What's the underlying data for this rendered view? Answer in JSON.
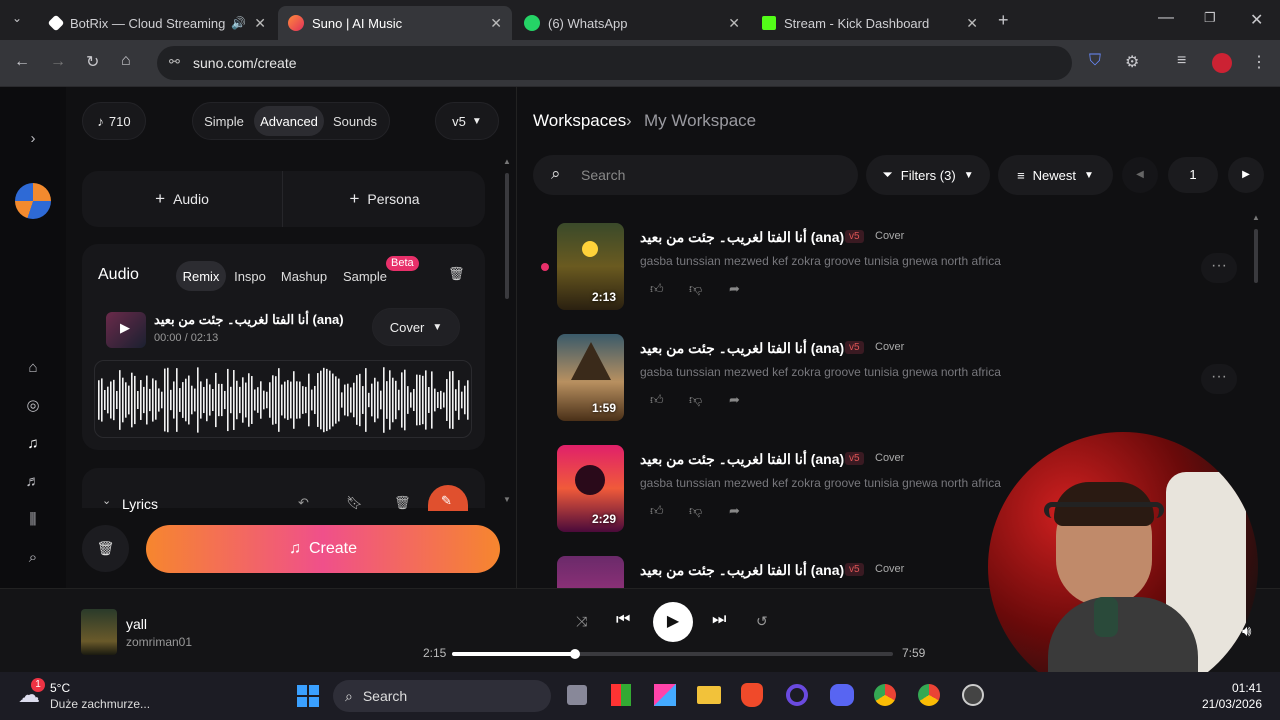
{
  "browser": {
    "tabs": [
      {
        "title": "BotRix — Cloud Streaming",
        "fav_color": "#ffffff",
        "active": false
      },
      {
        "title": "Suno | AI Music",
        "fav_color": "#ff5a3c",
        "active": true
      },
      {
        "title": "(6) WhatsApp",
        "fav_color": "#25d366",
        "active": false
      },
      {
        "title": "Stream - Kick Dashboard",
        "fav_color": "#53fc18",
        "active": false
      }
    ],
    "url": "suno.com/create"
  },
  "create": {
    "credits": "710",
    "modes": [
      "Simple",
      "Advanced",
      "Sounds"
    ],
    "active_mode": "Advanced",
    "version": "v5",
    "add_audio": "Audio",
    "add_persona": "Persona",
    "audio_card": {
      "title": "Audio",
      "tabs": [
        "Remix",
        "Inspo",
        "Mashup",
        "Sample"
      ],
      "beta_badge": "Beta",
      "song_title": "أنا الفتا لغريب۔ جئت من بعيد (ana)",
      "time": "00:00 / 02:13",
      "mode_select": "Cover"
    },
    "lyrics_label": "Lyrics",
    "create_button": "Create"
  },
  "workspace": {
    "breadcrumb_root": "Workspaces",
    "breadcrumb_current": "My Workspace",
    "search_placeholder": "Search",
    "filters": "Filters (3)",
    "sort": "Newest",
    "page": "1",
    "songs": [
      {
        "title": "أنا الفتا لغريب۔ جئت من بعيد (ana)",
        "version": "v5",
        "type": "Cover",
        "desc": "gasba tunssian mezwed kef zokra groove tunisia gnewa north africa",
        "duration": "2:13"
      },
      {
        "title": "أنا الفتا لغريب۔ جئت من بعيد (ana)",
        "version": "v5",
        "type": "Cover",
        "desc": "gasba tunssian mezwed kef zokra groove tunisia gnewa north africa",
        "duration": "1:59"
      },
      {
        "title": "أنا الفتا لغريب۔ جئت من بعيد (ana)",
        "version": "v5",
        "type": "Cover",
        "desc": "gasba tunssian mezwed kef zokra groove tunisia gnewa north africa",
        "duration": "2:29"
      },
      {
        "title": "أنا الفتا لغريب۔ جئت من بعيد (ana)",
        "version": "v5",
        "type": "Cover",
        "desc": "",
        "duration": ""
      }
    ]
  },
  "player": {
    "track": "yall",
    "artist": "zomriman01",
    "elapsed": "2:15",
    "total": "7:59",
    "progress": 0.28
  },
  "taskbar": {
    "weather_temp": "5°C",
    "weather_desc": "Duże zachmurze...",
    "weather_badge": "1",
    "search": "Search",
    "time": "01:41",
    "date": "21/03/2026"
  }
}
